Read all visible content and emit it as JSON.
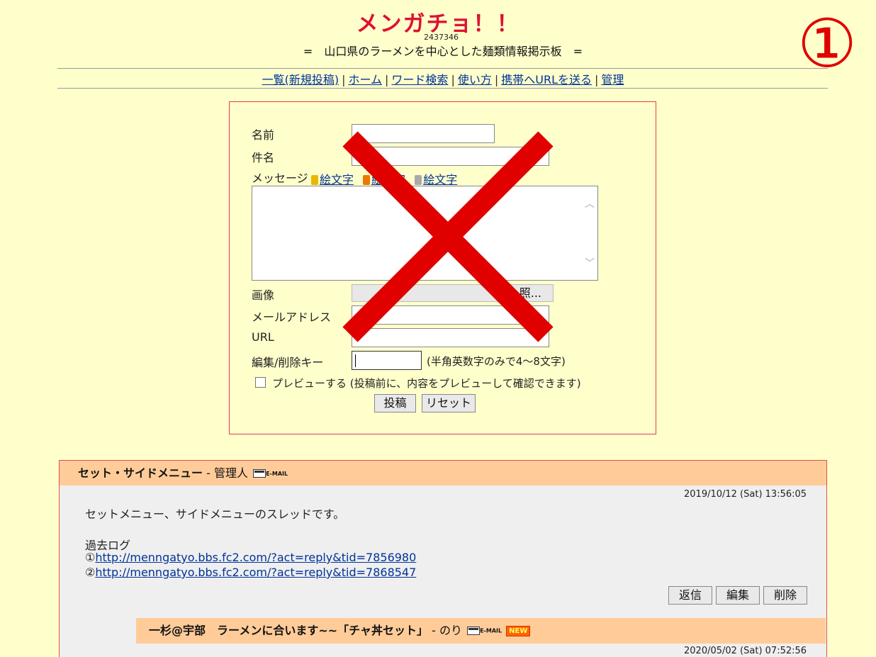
{
  "header": {
    "title": "メンガチョ！！",
    "counter": "2437346",
    "subtitle": "=　山口県のラーメンを中心とした麺類情報掲示板　=",
    "badge": "①"
  },
  "nav": {
    "items": [
      "一覧(新規投稿)",
      "ホーム",
      "ワード検索",
      "使い方",
      "携帯へURLを送る",
      "管理"
    ]
  },
  "form": {
    "name_label": "名前",
    "subject_label": "件名",
    "message_label": "メッセージ",
    "emoji_links": [
      "絵文字",
      "絵文字",
      "絵文字"
    ],
    "image_label": "画像",
    "browse_label": "照...",
    "email_label": "メールアドレス",
    "url_label": "URL",
    "key_label": "編集/削除キー",
    "key_hint": "(半角英数字のみで4～8文字)",
    "preview_label": "プレビューする (投稿前に、内容をプレビューして確認できます)",
    "submit_label": "投稿",
    "reset_label": "リセット"
  },
  "thread": {
    "title": "セット・サイドメニュー",
    "author_sep": " - ",
    "author": "管理人",
    "mail_label": "E-MAIL",
    "date": "2019/10/12 (Sat) 13:56:05",
    "body_line1": "セットメニュー、サイドメニューのスレッドです。",
    "body_line2": "過去ログ",
    "log1_prefix": "①",
    "log1_link": "http://menngatyo.bbs.fc2.com/?act=reply&tid=7856980",
    "log2_prefix": "②",
    "log2_link": "http://menngatyo.bbs.fc2.com/?act=reply&tid=7868547",
    "reply_btn": "返信",
    "edit_btn": "編集",
    "delete_btn": "削除"
  },
  "reply": {
    "title": "一杉@宇部　ラーメンに合います~~「チャ丼セット」",
    "author_sep": " - ",
    "author": "のり",
    "mail_label": "E-MAIL",
    "new_badge": "NEW",
    "date": "2020/05/02 (Sat) 07:52:56"
  },
  "colors": {
    "background": "#ffffcc",
    "title": "#dd1133",
    "cross": "#e00000",
    "thread_header": "#ffcc99",
    "link": "#003399"
  }
}
